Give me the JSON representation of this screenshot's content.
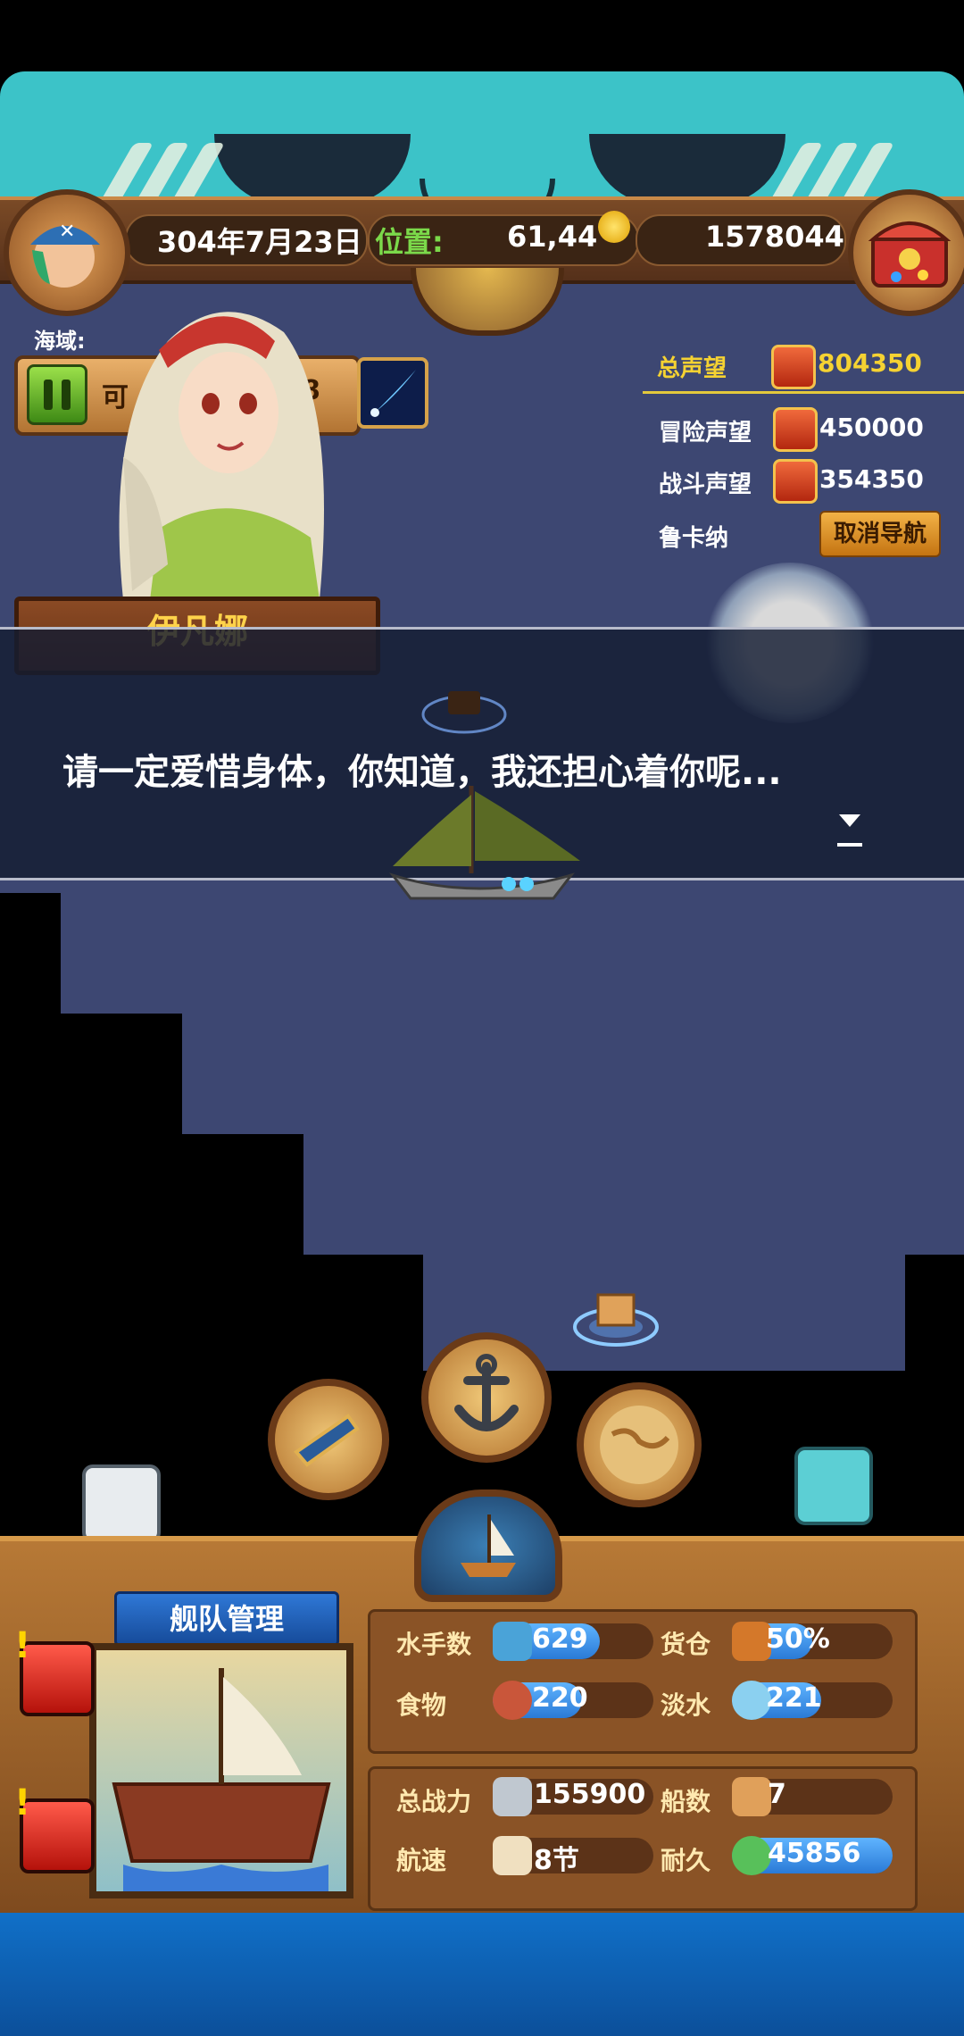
{
  "header": {
    "date": "304年7月23日",
    "position_label": "位置:",
    "position_value": "61,44",
    "gold": "1578044"
  },
  "left_panel": {
    "sea_label": "海域:",
    "status_fragment": "可",
    "status_number": "8"
  },
  "npc": {
    "name": "伊凡娜",
    "dialog": "请一定爱惜身体，你知道，我还担心着你呢..."
  },
  "reputation": {
    "total_label": "总声望",
    "total_value": "804350",
    "adventure_label": "冒险声望",
    "adventure_value": "450000",
    "battle_label": "战斗声望",
    "battle_value": "354350",
    "destination": "鲁卡纳",
    "cancel_nav": "取消导航"
  },
  "fleet": {
    "title": "舰队管理",
    "stats": {
      "sailors_label": "水手数",
      "sailors_value": "629",
      "cargo_label": "货仓",
      "cargo_value": "50%",
      "food_label": "食物",
      "food_value": "220",
      "water_label": "淡水",
      "water_value": "221",
      "power_label": "总战力",
      "power_value": "155900",
      "ships_label": "船数",
      "ships_value": "7",
      "speed_label": "航速",
      "speed_value": "8节",
      "durability_label": "耐久",
      "durability_value": "45856"
    },
    "fill_levels": {
      "sailors": 0.6,
      "cargo": 0.5,
      "food": 0.55,
      "water": 0.55,
      "durability": 1.0
    }
  },
  "colors": {
    "accent_yellow": "#f5d232",
    "sea": "#3d4772",
    "bar_blue": "#2a7ad6"
  },
  "icons": [
    "telescope-icon",
    "anchor-icon",
    "world-map-icon",
    "ship-icon",
    "treasure-chest-icon",
    "pause-icon",
    "comet-skill-icon"
  ]
}
